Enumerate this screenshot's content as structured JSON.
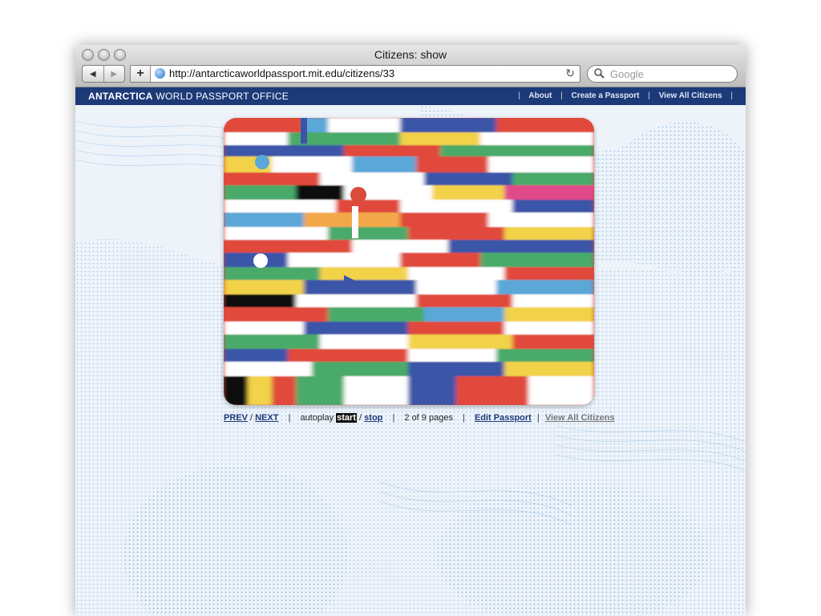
{
  "window": {
    "title": "Citizens: show"
  },
  "toolbar": {
    "back_glyph": "◀",
    "forward_glyph": "▶",
    "add_glyph": "+",
    "url": "http://antarcticaworldpassport.mit.edu/citizens/33",
    "reload_glyph": "↻",
    "search_placeholder": "Google",
    "icons": [
      "back-icon",
      "forward-icon",
      "globe-icon",
      "reload-icon",
      "search-icon"
    ]
  },
  "site": {
    "brand_bold": "ANTARCTICA",
    "brand_rest": "WORLD PASSPORT OFFICE",
    "nav": {
      "about": "About",
      "create": "Create a Passport",
      "view_all": "View All Citizens"
    },
    "separator": "|"
  },
  "viewer": {
    "prev": "PREV",
    "slash": "/",
    "next": "NEXT",
    "autoplay_label": "autoplay",
    "start": "start",
    "stop": "stop",
    "page_info": "2 of 9 pages",
    "edit": "Edit Passport",
    "view_all": "View All Citizens"
  },
  "colors": {
    "site_bar": "#1d3a78",
    "background": "#e9eff7",
    "pattern": "#8ab8de"
  }
}
